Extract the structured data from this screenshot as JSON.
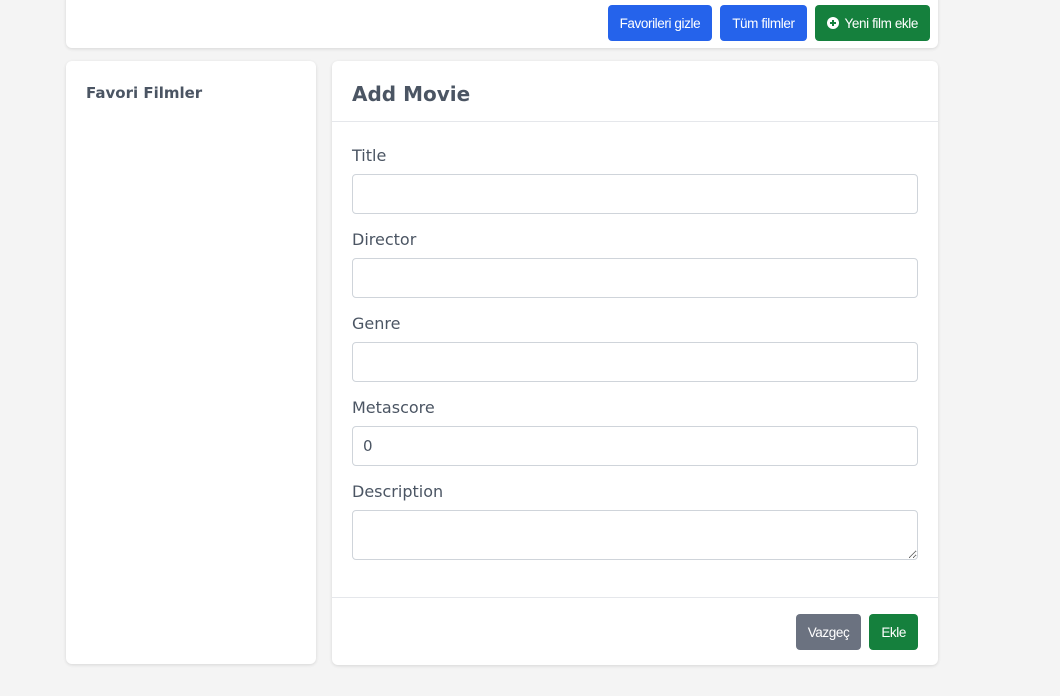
{
  "topbar": {
    "hide_favorites_label": "Favorileri gizle",
    "all_movies_label": "Tüm filmler",
    "add_movie_label": "Yeni film ekle"
  },
  "sidebar": {
    "title": "Favori Filmler"
  },
  "form": {
    "title": "Add Movie",
    "fields": {
      "title": {
        "label": "Title",
        "value": ""
      },
      "director": {
        "label": "Director",
        "value": ""
      },
      "genre": {
        "label": "Genre",
        "value": ""
      },
      "metascore": {
        "label": "Metascore",
        "value": "0"
      },
      "description": {
        "label": "Description",
        "value": ""
      }
    },
    "cancel_label": "Vazgeç",
    "submit_label": "Ekle"
  },
  "colors": {
    "primary": "#2563eb",
    "success": "#15803d",
    "secondary": "#6b7280",
    "background": "#f4f4f4"
  }
}
